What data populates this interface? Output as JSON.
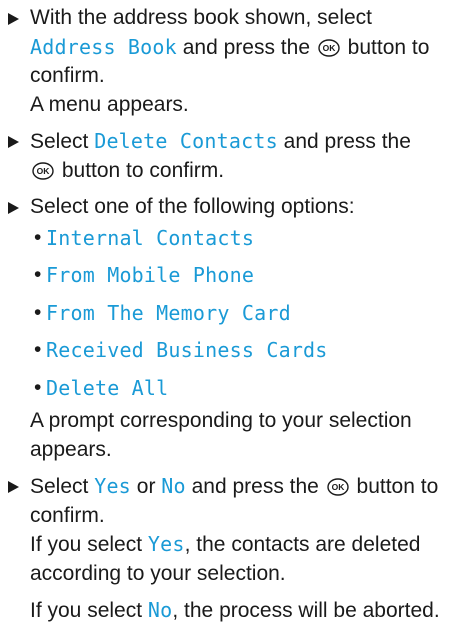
{
  "steps": [
    {
      "before": "With the address book shown, select ",
      "hl": "Address Book",
      "after1": " and press the ",
      "after2": " button to confirm.",
      "result": "A menu appears."
    },
    {
      "before": "Select ",
      "hl": "Delete Contacts",
      "after1": " and press the ",
      "after2": " button to confirm."
    },
    {
      "text": "Select one of the following options:",
      "options": [
        "Internal Contacts",
        "From Mobile Phone",
        "From The Memory Card",
        "Received Business Cards",
        "Delete All"
      ],
      "result": "A prompt corresponding to your selection appears."
    },
    {
      "before": "Select ",
      "hl_yes": "Yes",
      "mid": " or ",
      "hl_no": "No",
      "after1": " and press the ",
      "after2": " button to confirm.",
      "result_before": "If you select ",
      "result_hl": "Yes",
      "result_after": ", the contacts are deleted according to your selection."
    }
  ],
  "note": {
    "before": "If you select ",
    "hl": "No",
    "after": ", the process will be aborted."
  },
  "ok_icon_label": "OK",
  "accent_color": "#1a9ad6"
}
